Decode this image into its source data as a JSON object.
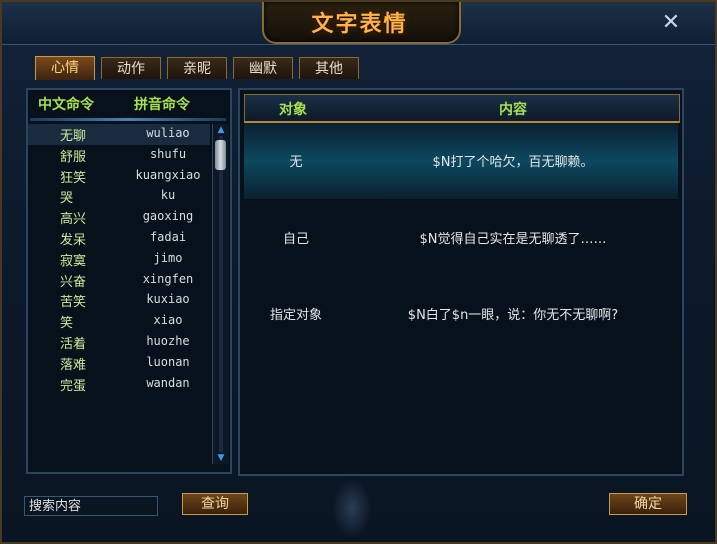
{
  "window": {
    "title": "文字表情",
    "close_glyph": "✕"
  },
  "tabs": [
    {
      "label": "心情",
      "active": true
    },
    {
      "label": "动作",
      "active": false
    },
    {
      "label": "亲昵",
      "active": false
    },
    {
      "label": "幽默",
      "active": false
    },
    {
      "label": "其他",
      "active": false
    }
  ],
  "command_list": {
    "col_chinese": "中文命令",
    "col_pinyin": "拼音命令",
    "selected_index": 0,
    "rows": [
      {
        "cn": "无聊",
        "py": "wuliao"
      },
      {
        "cn": "舒服",
        "py": "shufu"
      },
      {
        "cn": "狂笑",
        "py": "kuangxiao"
      },
      {
        "cn": "哭",
        "py": "ku"
      },
      {
        "cn": "高兴",
        "py": "gaoxing"
      },
      {
        "cn": "发呆",
        "py": "fadai"
      },
      {
        "cn": "寂寞",
        "py": "jimo"
      },
      {
        "cn": "兴奋",
        "py": "xingfen"
      },
      {
        "cn": "苦笑",
        "py": "kuxiao"
      },
      {
        "cn": "笑",
        "py": "xiao"
      },
      {
        "cn": "活着",
        "py": "huozhe"
      },
      {
        "cn": "落难",
        "py": "luonan"
      },
      {
        "cn": "完蛋",
        "py": "wandan"
      }
    ]
  },
  "details": {
    "col_target": "对象",
    "col_content": "内容",
    "rows": [
      {
        "target": "无",
        "text": "$N打了个哈欠，百无聊赖。"
      },
      {
        "target": "自己",
        "text": "$N觉得自己实在是无聊透了……"
      },
      {
        "target": "指定对象",
        "text": "$N白了$n一眼，说：你无不无聊啊?"
      }
    ]
  },
  "search": {
    "placeholder": "搜索内容",
    "button_label": "查询"
  },
  "confirm_label": "确定",
  "colors": {
    "accent": "#ffb347",
    "header_green": "#a6e04f",
    "border_gold": "#8b6a2e"
  }
}
